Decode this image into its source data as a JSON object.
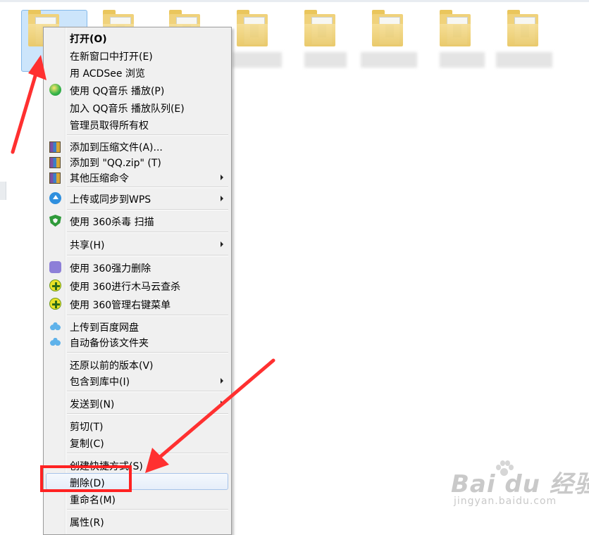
{
  "context_menu": {
    "items": [
      {
        "label": "打开(O)",
        "icon": "",
        "bold": true,
        "submenu": false
      },
      {
        "label": "在新窗口中打开(E)",
        "icon": "",
        "submenu": false
      },
      {
        "label": "用 ACDSee 浏览",
        "icon": "",
        "submenu": false
      },
      {
        "label": "使用 QQ音乐 播放(P)",
        "icon": "qq-music-icon",
        "submenu": false
      },
      {
        "label": "加入 QQ音乐 播放队列(E)",
        "icon": "",
        "submenu": false
      },
      {
        "label": "管理员取得所有权",
        "icon": "",
        "submenu": false
      },
      {
        "label": "添加到压缩文件(A)...",
        "icon": "winrar-icon",
        "submenu": false
      },
      {
        "label": "添加到 \"QQ.zip\" (T)",
        "icon": "winrar-icon",
        "submenu": false
      },
      {
        "label": "其他压缩命令",
        "icon": "winrar-icon",
        "submenu": true
      },
      {
        "label": "上传或同步到WPS",
        "icon": "wps-cloud-icon",
        "submenu": true
      },
      {
        "label": "使用 360杀毒 扫描",
        "icon": "360-shield-icon",
        "submenu": false
      },
      {
        "label": "共享(H)",
        "icon": "",
        "submenu": true
      },
      {
        "label": "使用 360强力删除",
        "icon": "360-eraser-icon",
        "submenu": false
      },
      {
        "label": "使用 360进行木马云查杀",
        "icon": "360-plus-icon",
        "submenu": false
      },
      {
        "label": "使用 360管理右键菜单",
        "icon": "360-plus-icon",
        "submenu": false
      },
      {
        "label": "上传到百度网盘",
        "icon": "baidu-cloud-icon",
        "submenu": false
      },
      {
        "label": "自动备份该文件夹",
        "icon": "baidu-cloud-icon",
        "submenu": false
      },
      {
        "label": "还原以前的版本(V)",
        "icon": "",
        "submenu": false
      },
      {
        "label": "包含到库中(I)",
        "icon": "",
        "submenu": true
      },
      {
        "label": "发送到(N)",
        "icon": "",
        "submenu": true
      },
      {
        "label": "剪切(T)",
        "icon": "",
        "submenu": false
      },
      {
        "label": "复制(C)",
        "icon": "",
        "submenu": false
      },
      {
        "label": "创建快捷方式(S)",
        "icon": "",
        "submenu": false
      },
      {
        "label": "删除(D)",
        "icon": "",
        "submenu": false,
        "highlighted": true
      },
      {
        "label": "重命名(M)",
        "icon": "",
        "submenu": false
      },
      {
        "label": "属性(R)",
        "icon": "",
        "submenu": false
      }
    ]
  },
  "watermark": {
    "logo": "Bai du 经验",
    "url": "jingyan.baidu.com"
  },
  "colors": {
    "annotation_red": "#ff2222",
    "menu_background": "#f0f0f0",
    "selection_blue": "#cce5fb"
  }
}
